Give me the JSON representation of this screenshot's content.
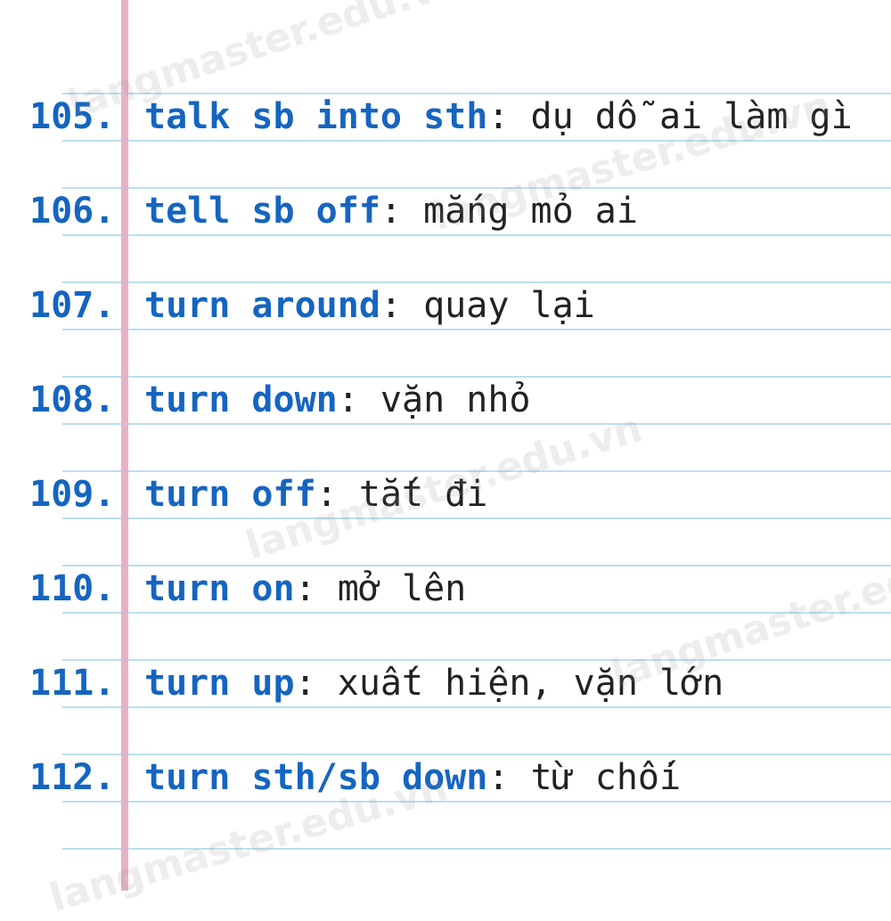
{
  "entries": [
    {
      "number": "105.",
      "term": "talk sb into sth",
      "colon": ":",
      "meaning": " dụ dỗ ai làm gì"
    },
    {
      "number": "106.",
      "term": "tell sb off",
      "colon": ":",
      "meaning": " mắng mỏ ai"
    },
    {
      "number": "107.",
      "term": "turn around",
      "colon": ":",
      "meaning": " quay lại"
    },
    {
      "number": "108.",
      "term": "turn down",
      "colon": ":",
      "meaning": " vặn nhỏ"
    },
    {
      "number": "109.",
      "term": "turn off",
      "colon": ":",
      "meaning": " tắt đi"
    },
    {
      "number": "110.",
      "term": "turn on",
      "colon": ":",
      "meaning": " mở lên"
    },
    {
      "number": "111.",
      "term": "turn up",
      "colon": ":",
      "meaning": " xuất hiện, vặn lớn"
    },
    {
      "number": "112.",
      "term": "turn sth/sb down",
      "colon": ":",
      "meaning": " từ chối"
    }
  ],
  "watermark_text": "langmaster.edu.vn",
  "colors": {
    "term": "#1565c0",
    "number": "#1565c0",
    "meaning": "#222222",
    "rule_line": "#bcdfee",
    "margin_line": "#e6b3c6"
  }
}
